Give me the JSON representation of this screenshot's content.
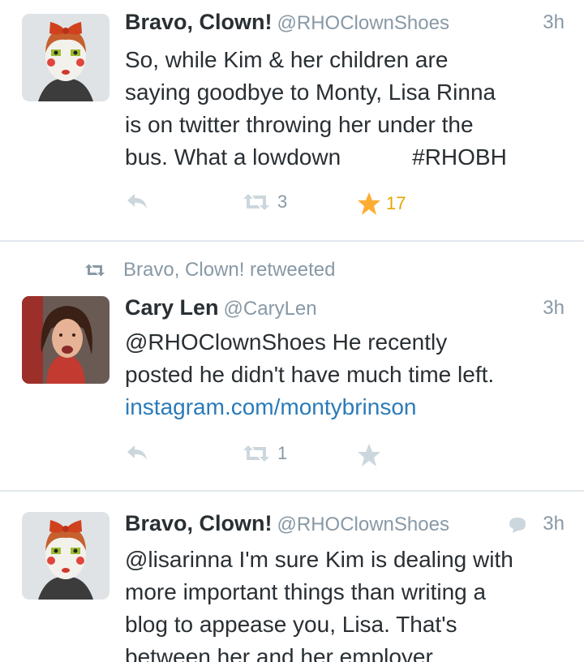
{
  "tweets": [
    {
      "name": "Bravo, Clown!",
      "handle": "@RHOClownShoes",
      "time": "3h",
      "lines": [
        "So, while Kim & her children are",
        "saying goodbye to Monty, Lisa Rinna",
        "is on twitter throwing her under the",
        "bus. What a lowdown"
      ],
      "hashtag": "#RHOBH",
      "retweets": "3",
      "favorites": "17"
    },
    {
      "context": "Bravo, Clown! retweeted",
      "name": "Cary Len",
      "handle": "@CaryLen",
      "time": "3h",
      "lines": [
        "@RHOClownShoes He recently",
        "posted he didn't have much time left."
      ],
      "link": "instagram.com/montybrinson",
      "retweets": "1"
    },
    {
      "name": "Bravo, Clown!",
      "handle": "@RHOClownShoes",
      "time": "3h",
      "lines": [
        "@lisarinna I'm sure Kim is dealing with",
        "more important things than writing a",
        "blog to appease you, Lisa. That's",
        "between her and her employer."
      ]
    }
  ],
  "colors": {
    "text": "#292f33",
    "muted": "#8899a6",
    "link": "#2b7bb9",
    "favorite_active": "#e2a600",
    "divider": "#e1e8ed"
  },
  "icons": [
    "reply-icon",
    "retweet-icon",
    "favorite-star-icon",
    "conversation-bubble-icon"
  ]
}
